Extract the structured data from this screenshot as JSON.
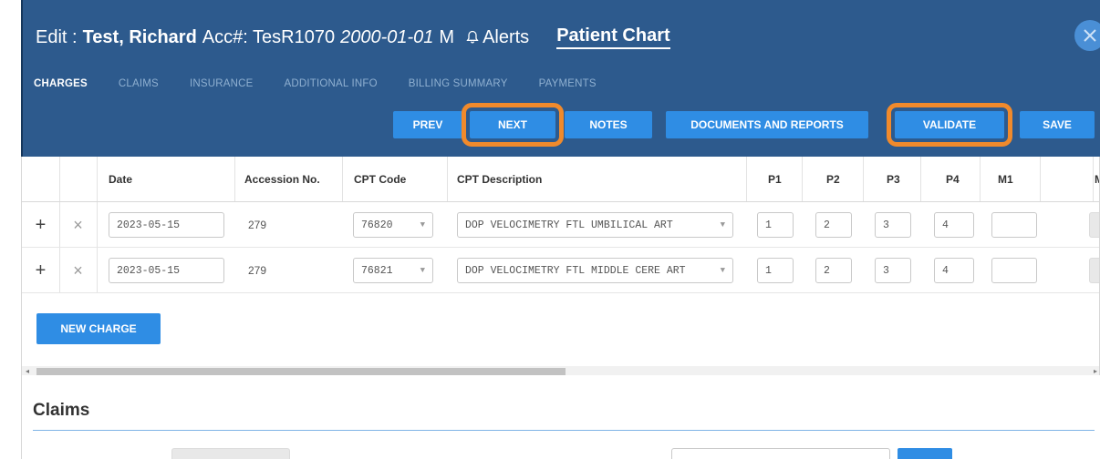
{
  "header": {
    "edit_label": "Edit :",
    "patient_name": "Test, Richard",
    "acc_label": "Acc#: TesR1070",
    "dob": "2000-01-01",
    "sex": "M",
    "alerts_label": "Alerts",
    "patient_chart_label": "Patient Chart"
  },
  "tabs": [
    {
      "label": "CHARGES",
      "active": true
    },
    {
      "label": "CLAIMS",
      "active": false
    },
    {
      "label": "INSURANCE",
      "active": false
    },
    {
      "label": "ADDITIONAL INFO",
      "active": false
    },
    {
      "label": "BILLING SUMMARY",
      "active": false
    },
    {
      "label": "PAYMENTS",
      "active": false
    }
  ],
  "toolbar": {
    "prev": "PREV",
    "next": "NEXT",
    "notes": "NOTES",
    "documents": "DOCUMENTS AND REPORTS",
    "validate": "VALIDATE",
    "save": "SAVE"
  },
  "table": {
    "headers": {
      "date": "Date",
      "accession": "Accession No.",
      "cpt_code": "CPT Code",
      "cpt_desc": "CPT Description",
      "p1": "P1",
      "p2": "P2",
      "p3": "P3",
      "p4": "P4",
      "m1": "M1",
      "m2": "M"
    },
    "rows": [
      {
        "date": "2023-05-15",
        "accession": "279",
        "cpt_code": "76820",
        "cpt_desc": "DOP VELOCIMETRY FTL UMBILICAL ART",
        "p1": "1",
        "p2": "2",
        "p3": "3",
        "p4": "4",
        "m1": ""
      },
      {
        "date": "2023-05-15",
        "accession": "279",
        "cpt_code": "76821",
        "cpt_desc": "DOP VELOCIMETRY FTL MIDDLE CERE ART",
        "p1": "1",
        "p2": "2",
        "p3": "3",
        "p4": "4",
        "m1": ""
      }
    ],
    "new_charge": "NEW CHARGE"
  },
  "claims": {
    "title": "Claims"
  },
  "colors": {
    "header_bg": "#2d5a8d",
    "button_blue": "#2f8de4",
    "highlight_orange": "#f08a2c"
  },
  "icons": {
    "alerts": "bell-icon",
    "close": "close-icon",
    "add": "plus-icon",
    "delete": "x-icon",
    "dropdown": "chevron-down-icon"
  }
}
